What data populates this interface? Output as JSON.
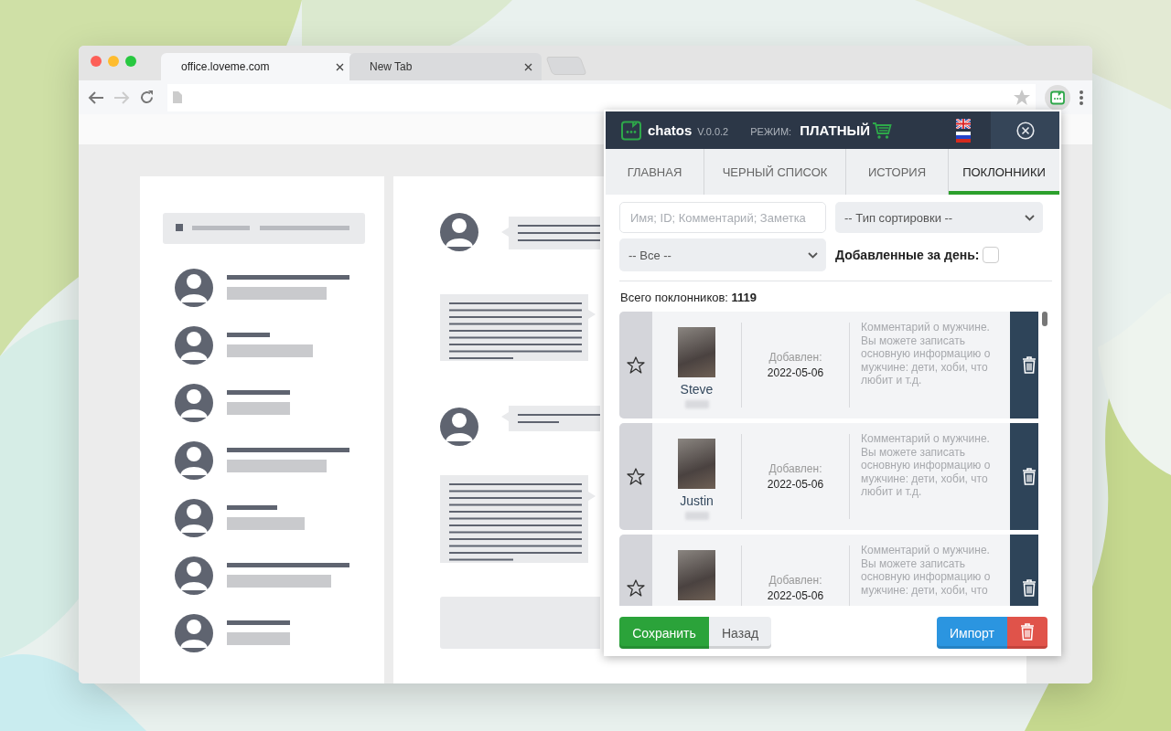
{
  "browser": {
    "tabs": [
      {
        "label": "office.loveme.com",
        "selected": true
      },
      {
        "label": "New Tab",
        "selected": false
      }
    ]
  },
  "popup": {
    "app_name": "chatos",
    "version": "V.0.0.2",
    "mode_label": "РЕЖИМ:",
    "mode_value": "ПЛАТНЫЙ",
    "tabs": [
      {
        "label": "ГЛАВНАЯ",
        "selected": false
      },
      {
        "label": "ЧЕРНЫЙ СПИСОК",
        "selected": false
      },
      {
        "label": "ИСТОРИЯ",
        "selected": false
      },
      {
        "label": "ПОКЛОННИКИ",
        "selected": true
      }
    ],
    "search": {
      "placeholder": "Имя; ID; Комментарий; Заметка"
    },
    "sort_select": {
      "value": "-- Тип сортировки --"
    },
    "filter_select": {
      "value": "-- Все --"
    },
    "daily_filter": {
      "label": "Добавленные за день:",
      "checked": false
    },
    "total_label": "Всего поклонников:",
    "total_value": "1119",
    "fans": [
      {
        "name": "Steve",
        "added_label": "Добавлен:",
        "date": "2022-05-06",
        "comment": "Комментарий о мужчине. Вы можете записать основную информацию о мужчине: дети, хоби, что любит и т.д.",
        "starred": false
      },
      {
        "name": "Justin",
        "added_label": "Добавлен:",
        "date": "2022-05-06",
        "comment": "Комментарий о мужчине. Вы можете записать основную информацию о мужчине: дети, хоби, что любит и т.д.",
        "starred": false
      },
      {
        "added_label": "Добавлен:",
        "date": "2022-05-06",
        "comment": "Комментарий о мужчине. Вы можете записать основную информацию о мужчине: дети, хоби, что",
        "starred": false
      }
    ],
    "buttons": {
      "save": "Сохранить",
      "back": "Назад",
      "import": "Импорт"
    }
  }
}
